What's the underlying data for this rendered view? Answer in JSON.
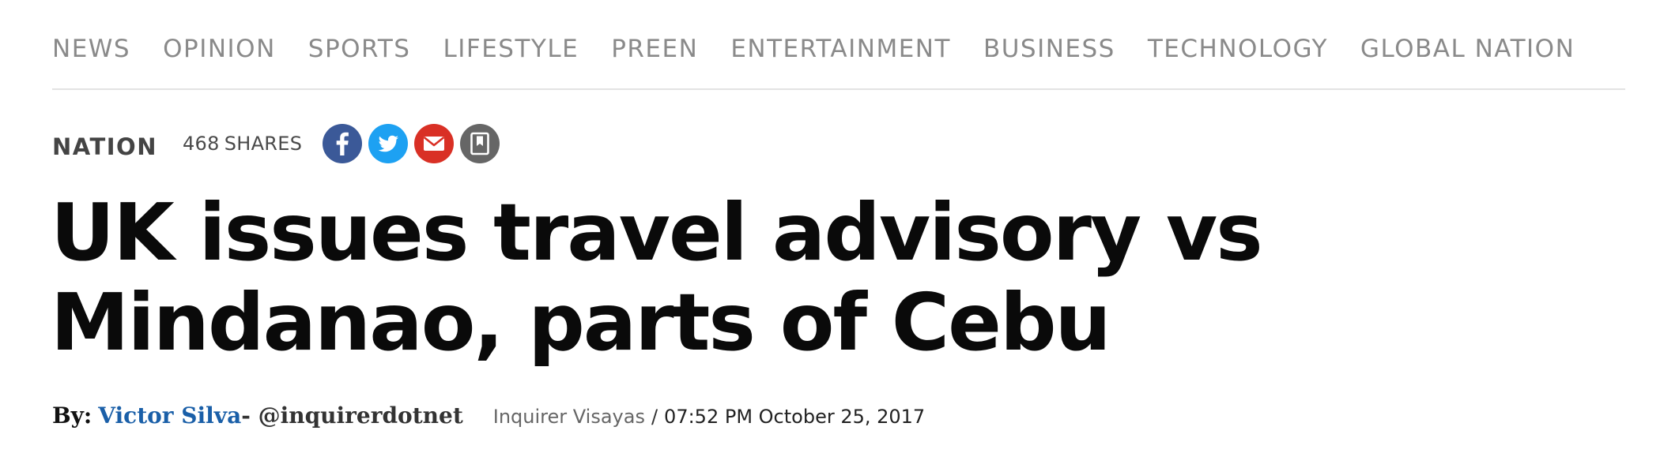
{
  "nav": {
    "items": [
      {
        "label": "NEWS"
      },
      {
        "label": "OPINION"
      },
      {
        "label": "SPORTS"
      },
      {
        "label": "LIFESTYLE"
      },
      {
        "label": "PREEN"
      },
      {
        "label": "ENTERTAINMENT"
      },
      {
        "label": "BUSINESS"
      },
      {
        "label": "TECHNOLOGY"
      },
      {
        "label": "GLOBAL NATION"
      }
    ]
  },
  "article": {
    "section": "NATION",
    "shares_count": "468",
    "shares_label": "SHARES",
    "share_buttons": [
      {
        "icon": "facebook-icon",
        "color": "#3b5998"
      },
      {
        "icon": "twitter-icon",
        "color": "#1da1f2"
      },
      {
        "icon": "email-icon",
        "color": "#d93025"
      },
      {
        "icon": "bookmark-icon",
        "color": "#666666"
      }
    ],
    "headline": "UK issues travel advisory vs Mindanao, parts of Cebu",
    "byline": {
      "prefix": "By:",
      "author": "Victor Silva",
      "handle": "- @inquirerdotnet",
      "source": "Inquirer Visayas",
      "separator": "/",
      "datetime": "07:52 PM October 25, 2017"
    }
  },
  "colors": {
    "author_link": "#1a5fa8",
    "nav_text": "#8a8a8a"
  }
}
